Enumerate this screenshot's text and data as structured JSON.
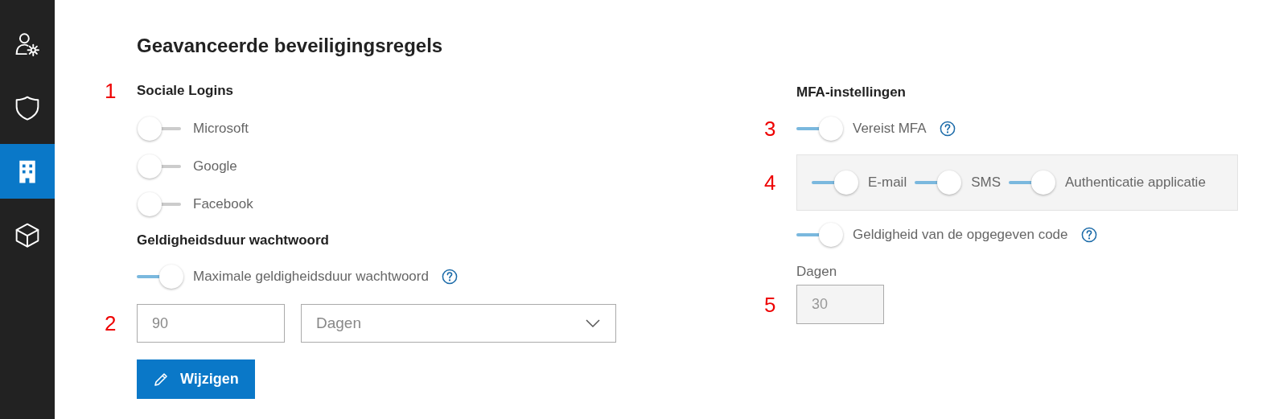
{
  "sidebar": {
    "items": [
      {
        "kind": "user-gear",
        "selected": false
      },
      {
        "kind": "shield",
        "selected": false
      },
      {
        "kind": "building",
        "selected": true
      },
      {
        "kind": "cube",
        "selected": false
      }
    ]
  },
  "title": "Geavanceerde beveiligingsregels",
  "social_logins": {
    "marker": "1",
    "heading": "Sociale Logins",
    "toggles": [
      {
        "label": "Microsoft",
        "on": false
      },
      {
        "label": "Google",
        "on": false
      },
      {
        "label": "Facebook",
        "on": false
      }
    ]
  },
  "password_validity": {
    "heading": "Geldigheidsduur wachtwoord",
    "toggle": {
      "label": "Maximale geldigheidsduur wachtwoord",
      "on": true,
      "help": true
    },
    "marker": "2",
    "value_field": {
      "value": "90"
    },
    "unit_select": {
      "value": "Dagen"
    },
    "button": {
      "label": "Wijzigen"
    }
  },
  "mfa": {
    "heading": "MFA-instellingen",
    "require": {
      "marker": "3",
      "label": "Vereist MFA",
      "on": true,
      "help": true
    },
    "methods": {
      "marker": "4",
      "toggles": [
        {
          "label": "E-mail",
          "on": true
        },
        {
          "label": "SMS",
          "on": true
        },
        {
          "label": "Authenticatie applicatie",
          "on": true
        }
      ]
    },
    "code_validity": {
      "label": "Geldigheid van de opgegeven code",
      "on": true,
      "help": true
    },
    "days": {
      "label": "Dagen",
      "marker": "5",
      "value": "30",
      "disabled": true
    }
  }
}
